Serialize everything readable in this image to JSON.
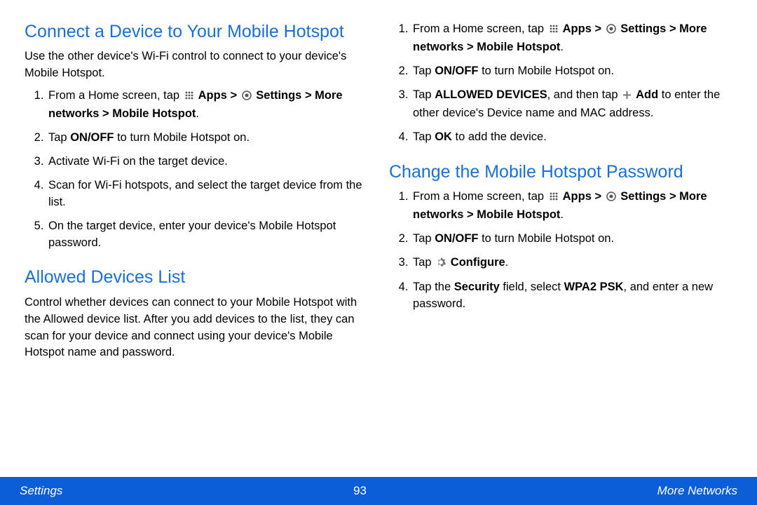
{
  "left": {
    "h1": "Connect a Device to Your Mobile Hotspot",
    "p1": "Use the other device's Wi-Fi control to connect to your device's Mobile Hotspot.",
    "l1a": "From a Home screen, tap ",
    "l1b": " Apps > ",
    "l1c": " Settings > More networks > Mobile Hotspot",
    "l1d": ".",
    "l2a": "Tap ",
    "l2b": "ON/OFF",
    "l2c": " to turn Mobile Hotspot on.",
    "l3": "Activate Wi-Fi on the target device.",
    "l4": "Scan for Wi-Fi hotspots, and select the target device from the list.",
    "l5": "On the target device, enter your device's Mobile Hotspot password.",
    "h2": "Allowed Devices List",
    "p2": "Control whether devices can connect to your Mobile Hotspot with the Allowed device list. After you add devices to the list, they can scan for your device and connect using your device's Mobile Hotspot name and password."
  },
  "right": {
    "a1a": "From a Home screen, tap ",
    "a1b": " Apps > ",
    "a1c": " Settings > More networks > Mobile Hotspot",
    "a1d": ".",
    "a2a": "Tap ",
    "a2b": "ON/OFF",
    "a2c": " to turn Mobile Hotspot on.",
    "a3a": "Tap ",
    "a3b": "ALLOWED DEVICES",
    "a3c": ", and then tap ",
    "a3d": " Add",
    "a3e": " to enter the other device's Device name and MAC address.",
    "a4a": "Tap ",
    "a4b": "OK",
    "a4c": " to add the device.",
    "h1": "Change the Mobile Hotspot Password",
    "b1a": "From a Home screen, tap ",
    "b1b": " Apps > ",
    "b1c": " Settings > More networks > Mobile Hotspot",
    "b1d": ".",
    "b2a": "Tap ",
    "b2b": "ON/OFF",
    "b2c": " to turn Mobile Hotspot on.",
    "b3a": "Tap ",
    "b3b": " Configure",
    "b3c": ".",
    "b4a": "Tap the ",
    "b4b": "Security",
    "b4c": " field, select ",
    "b4d": "WPA2 PSK",
    "b4e": ", and enter a new password."
  },
  "footer": {
    "left": "Settings",
    "center": "93",
    "right": "More Networks"
  }
}
